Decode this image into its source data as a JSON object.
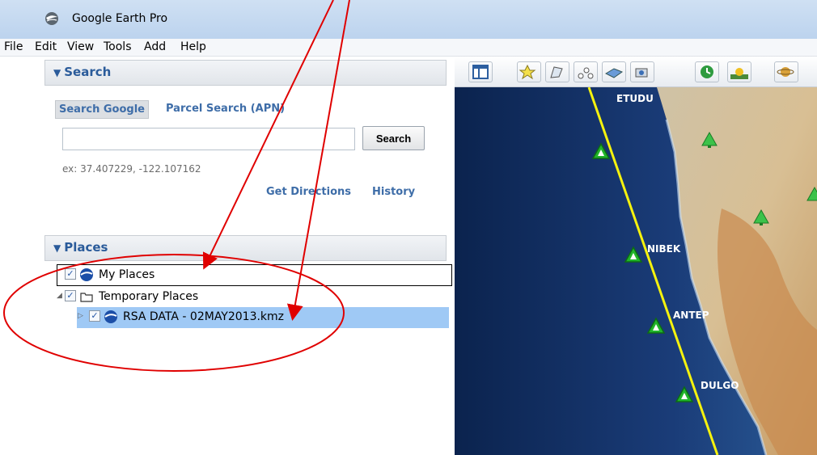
{
  "window": {
    "title": "Google Earth Pro"
  },
  "menu": [
    "File",
    "Edit",
    "View",
    "Tools",
    "Add",
    "Help"
  ],
  "search_panel": {
    "header": "Search",
    "tabs": {
      "google": "Search Google",
      "parcel": "Parcel Search (APN)"
    },
    "input_value": "",
    "button": "Search",
    "example": "ex: 37.407229, -122.107162",
    "links": {
      "directions": "Get Directions",
      "history": "History"
    }
  },
  "places_panel": {
    "header": "Places",
    "items": [
      {
        "label": "My Places",
        "checked": true
      },
      {
        "label": "Temporary Places",
        "checked": true
      },
      {
        "label": "RSA DATA - 02MAY2013.kmz",
        "checked": true,
        "selected": true
      }
    ]
  },
  "map": {
    "waypoints": [
      "ETUDU",
      "NIBEK",
      "ANTEP",
      "DULGO"
    ],
    "route_color": "#f5f20e",
    "marker_color": "#21b52a"
  },
  "annotations": {
    "color": "#e00000"
  },
  "icons": {
    "title": "google-earth-icon",
    "toolbar": [
      "sidebar-toggle-icon",
      "add-placemark-icon",
      "add-polygon-icon",
      "add-path-icon",
      "add-image-overlay-icon",
      "record-tour-icon",
      "historical-imagery-icon",
      "sunlight-icon",
      "planets-icon"
    ]
  }
}
